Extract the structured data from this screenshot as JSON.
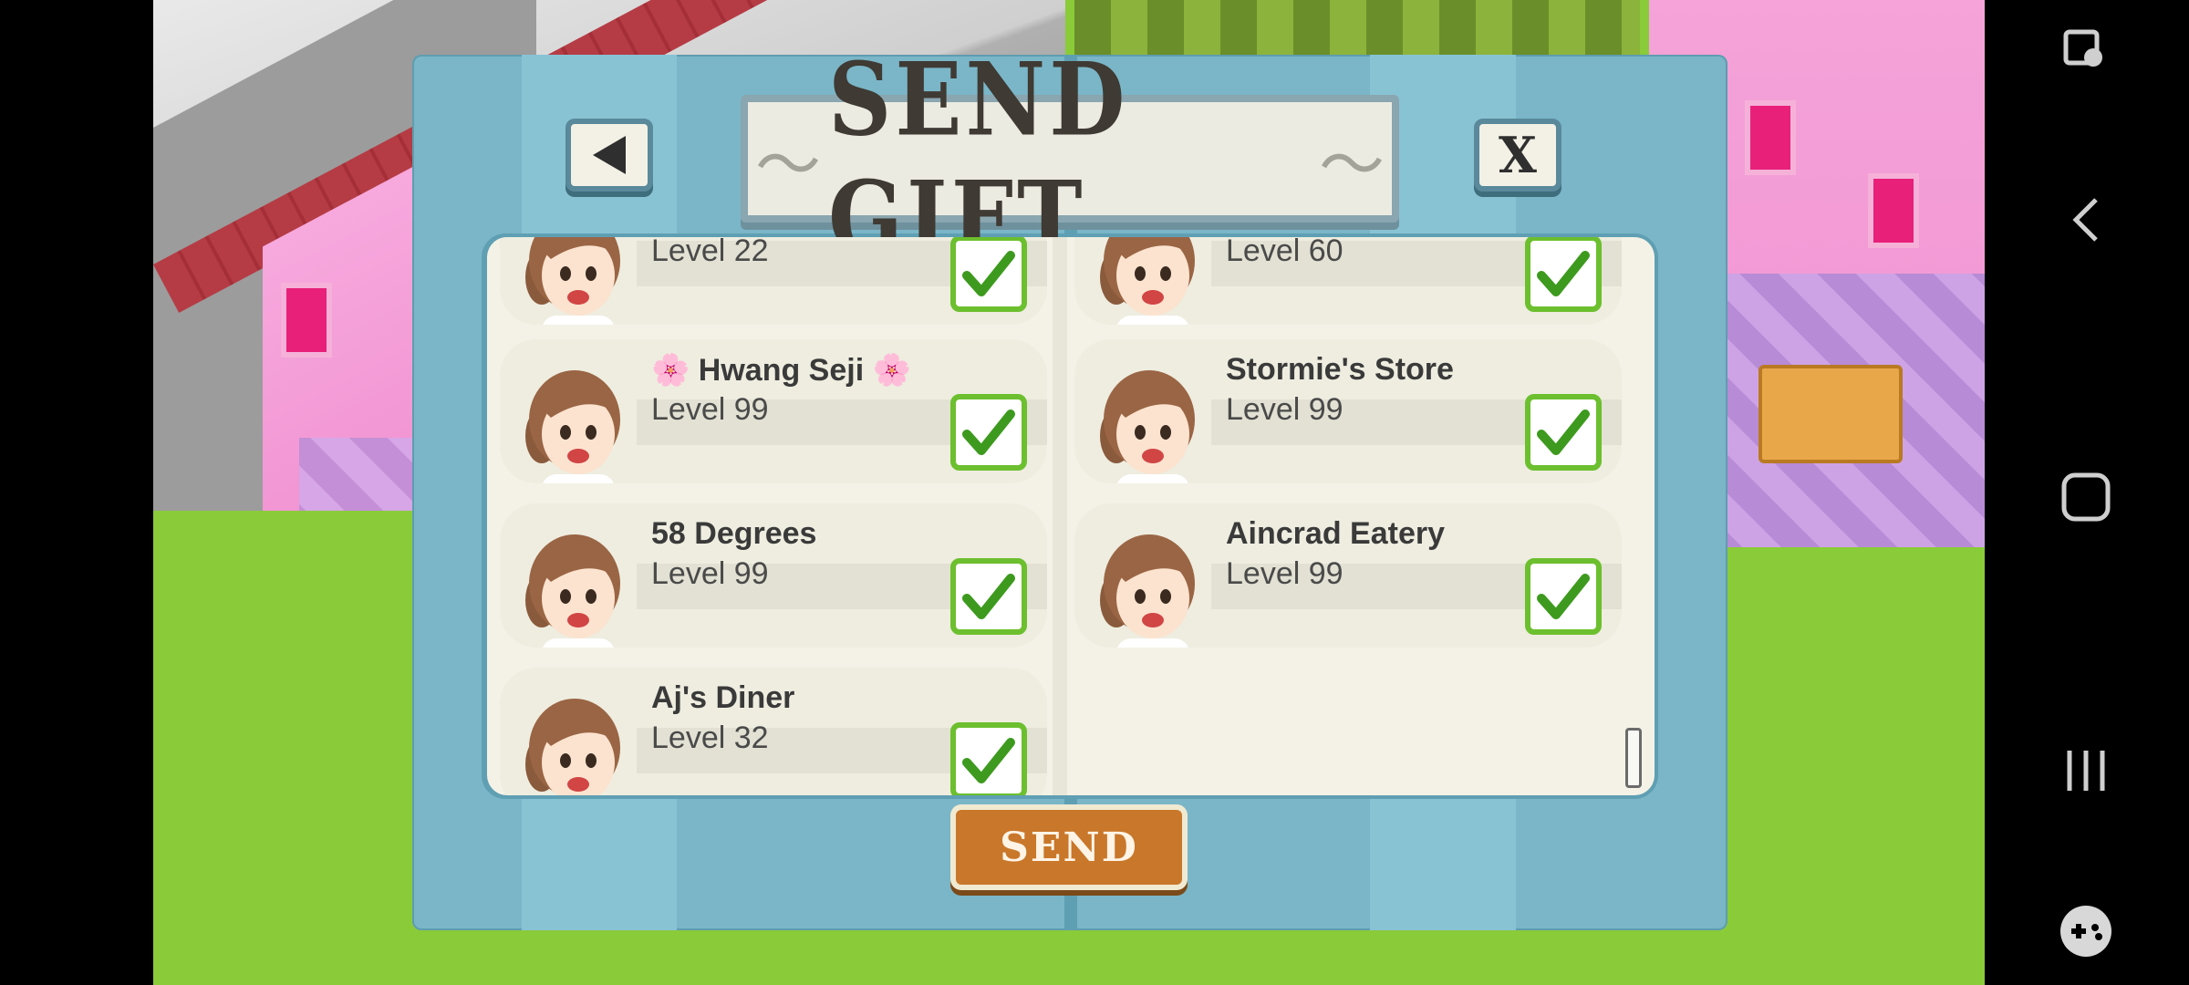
{
  "dialog": {
    "title": "SEND GIFT",
    "close_label": "X",
    "send_label": "SEND"
  },
  "friends": [
    {
      "name": "",
      "level": "Level 22",
      "checked": true
    },
    {
      "name": "",
      "level": "Level 60",
      "checked": true
    },
    {
      "name": "🌸 Hwang Seji 🌸",
      "level": "Level 99",
      "checked": true
    },
    {
      "name": "Stormie's Store",
      "level": "Level 99",
      "checked": true
    },
    {
      "name": "58 Degrees",
      "level": "Level 99",
      "checked": true
    },
    {
      "name": "Aincrad Eatery",
      "level": "Level 99",
      "checked": true
    },
    {
      "name": "Aj's Diner",
      "level": "Level 32",
      "checked": true
    }
  ],
  "system_nav": {
    "icons": [
      "screenshot-touch-icon",
      "back-icon",
      "home-icon",
      "recents-icon",
      "game-tools-icon"
    ]
  },
  "colors": {
    "dialog_frame": "#7ab6c8",
    "list_background": "#f4f2e6",
    "check_green": "#6cbf2e",
    "send_button": "#c9772a"
  }
}
